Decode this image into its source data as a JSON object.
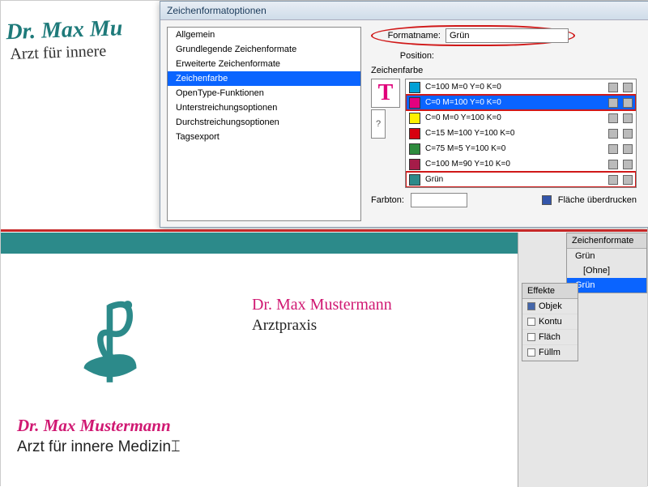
{
  "bg": {
    "name": "Dr. Max Mu",
    "sub": "Arzt für innere "
  },
  "dialog": {
    "title": "Zeichenformatoptionen",
    "categories": [
      "Allgemein",
      "Grundlegende Zeichenformate",
      "Erweiterte Zeichenformate",
      "Zeichenfarbe",
      "OpenType-Funktionen",
      "Unterstreichungsoptionen",
      "Durchstreichungsoptionen",
      "Tagsexport"
    ],
    "selectedCategory": 3,
    "formatnameLabel": "Formatname:",
    "formatnameValue": "Grün",
    "positionLabel": "Position:",
    "sectionTitle": "Zeichenfarbe",
    "swatches": [
      {
        "color": "#00a0d6",
        "name": "C=100 M=0 Y=0 K=0"
      },
      {
        "color": "#e4007f",
        "name": "C=0 M=100 Y=0 K=0",
        "selected": true,
        "red": true
      },
      {
        "color": "#fff100",
        "name": "C=0 M=0 Y=100 K=0"
      },
      {
        "color": "#d7000f",
        "name": "C=15 M=100 Y=100 K=0"
      },
      {
        "color": "#2e8b3d",
        "name": "C=75 M=5 Y=100 K=0"
      },
      {
        "color": "#a51c49",
        "name": "C=100 M=90 Y=10 K=0"
      },
      {
        "color": "#2c8a8a",
        "name": "Grün",
        "red": true
      }
    ],
    "farbtonLabel": "Farbton:",
    "overprintLabel": "Fläche überdrucken"
  },
  "card": {
    "t1": "Dr. Max Mustermann",
    "t2": "Arztpraxis",
    "t3": "Dr. Max Mustermann",
    "t4": "Arzt für innere Medizin"
  },
  "zf": {
    "title": "Zeichenformate",
    "current": "Grün",
    "items": [
      "[Ohne]",
      "Grün"
    ],
    "selected": 1
  },
  "eff": {
    "title": "Effekte",
    "rows": [
      "Objek",
      "Kontu",
      "Fläch",
      "Füllm"
    ],
    "checked": 0
  }
}
